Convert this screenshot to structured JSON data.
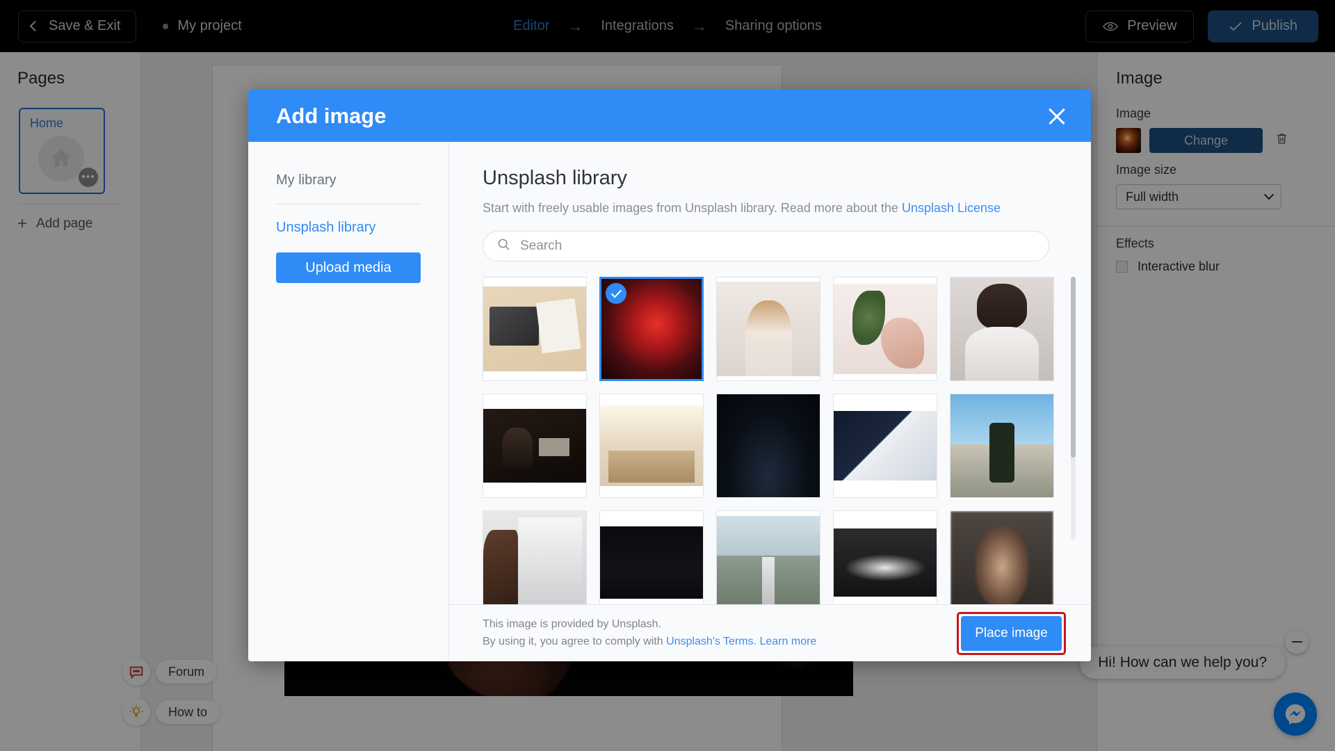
{
  "topbar": {
    "save_exit_label": "Save & Exit",
    "project_name": "My project",
    "nav_steps": [
      {
        "label": "Editor",
        "active": true
      },
      {
        "label": "Integrations",
        "active": false
      },
      {
        "label": "Sharing options",
        "active": false
      }
    ],
    "nav_arrow": "→",
    "preview_label": "Preview",
    "publish_label": "Publish",
    "accent_blue": "#2f8bf6",
    "publish_bg": "#1d4f82"
  },
  "pages_panel": {
    "title": "Pages",
    "page_card_label": "Home",
    "page_menu_dots": "•••",
    "add_page_label": "Add page",
    "add_page_icon": "+"
  },
  "right_panel": {
    "title": "Image",
    "image_label": "Image",
    "change_label": "Change",
    "delete_icon": "trash-icon",
    "image_size_label": "Image size",
    "image_size_value": "Full width",
    "image_size_options": [
      "Full width"
    ],
    "effects_label": "Effects",
    "interactive_blur_label": "Interactive blur",
    "interactive_blur_checked": false
  },
  "helpers": {
    "forum_label": "Forum",
    "how_to_label": "How to"
  },
  "chat": {
    "bubble_text": "Hi! How can we help you?",
    "minimize_icon": "minimize-icon",
    "fab_icon": "messenger-icon",
    "fab_color": "#0084ff"
  },
  "modal": {
    "title": "Add image",
    "close_icon": "close-icon",
    "header_bg": "#2f8bf6",
    "sidebar": {
      "items": [
        {
          "label": "My library",
          "active": false
        },
        {
          "label": "Unsplash library",
          "active": true
        }
      ],
      "upload_label": "Upload media"
    },
    "main": {
      "heading": "Unsplash library",
      "description_prefix": "Start with freely usable images from Unsplash library. Read more about the ",
      "description_link": "Unsplash License",
      "search_placeholder": "Search",
      "search_value": "",
      "search_icon": "search-icon",
      "thumbnails": [
        {
          "id": 1,
          "alt": "laptop-notebook-desk",
          "art": "a1",
          "selected": false
        },
        {
          "id": 2,
          "alt": "woman-in-red-light",
          "art": "a2",
          "selected": true
        },
        {
          "id": 3,
          "alt": "woman-in-white-coat",
          "art": "a3",
          "selected": false
        },
        {
          "id": 4,
          "alt": "hand-with-plant",
          "art": "a4",
          "selected": false
        },
        {
          "id": 5,
          "alt": "portrait-white-shirt",
          "art": "a5",
          "selected": false
        },
        {
          "id": 6,
          "alt": "man-at-desk-dark",
          "art": "a6",
          "selected": false
        },
        {
          "id": 7,
          "alt": "sunlit-office",
          "art": "a7",
          "selected": false
        },
        {
          "id": 8,
          "alt": "night-sky-water",
          "art": "a8",
          "selected": false
        },
        {
          "id": 9,
          "alt": "smartwatch-wrist",
          "art": "a9",
          "selected": false
        },
        {
          "id": 10,
          "alt": "skateboarder",
          "art": "a10",
          "selected": false
        },
        {
          "id": 11,
          "alt": "designer-at-monitor",
          "art": "a11",
          "selected": false
        },
        {
          "id": 12,
          "alt": "milky-way-silhouette",
          "art": "a12",
          "selected": false
        },
        {
          "id": 13,
          "alt": "empty-road-trees",
          "art": "a13",
          "selected": false
        },
        {
          "id": 14,
          "alt": "ballet-dancers-bw",
          "art": "a14",
          "selected": false
        },
        {
          "id": 15,
          "alt": "blurred-portrait",
          "art": "a15",
          "selected": false
        }
      ]
    },
    "footer": {
      "line1": "This image is provided by Unsplash.",
      "line2_prefix": "By using it, you agree to comply with ",
      "line2_link1": "Unsplash's Terms.",
      "line2_link2": "Learn more",
      "place_label": "Place image",
      "place_highlight_color": "#c5161c"
    }
  }
}
